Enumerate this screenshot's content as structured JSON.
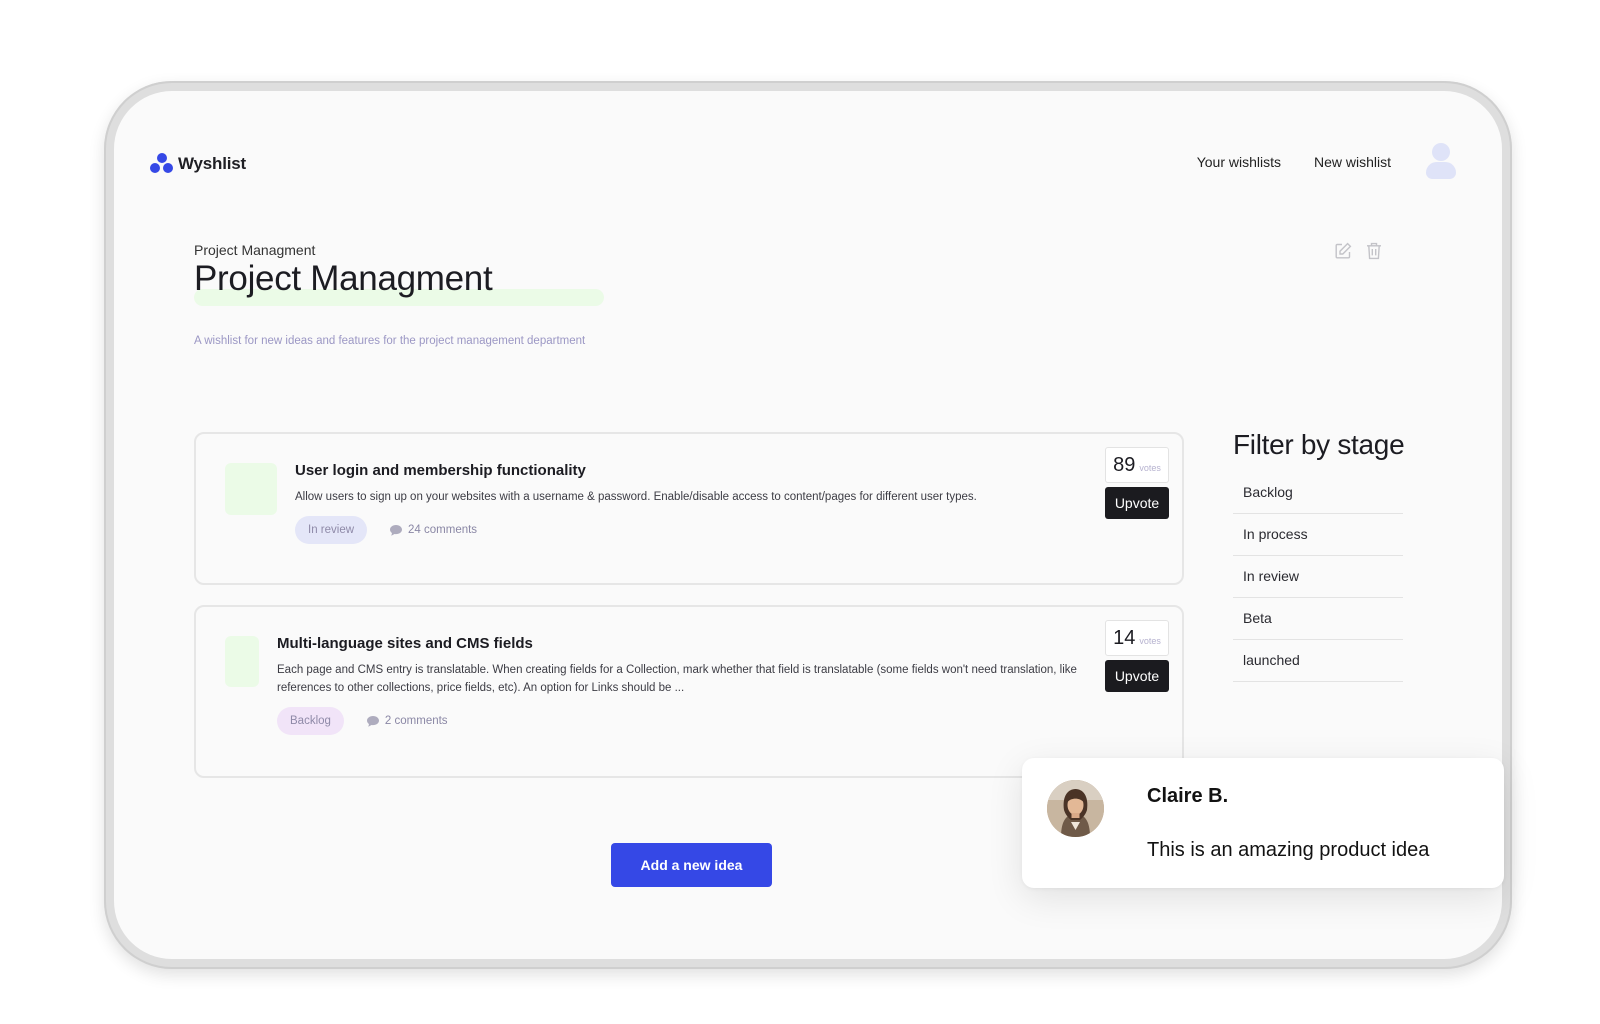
{
  "app": {
    "logo_text": "Wyshlist",
    "brand_color": "#3548e6"
  },
  "nav": {
    "your_wishlists": "Your wishlists",
    "new_wishlist": "New wishlist",
    "avatar_icon": "user-avatar-placeholder"
  },
  "page": {
    "breadcrumb": "Project Managment",
    "title": "Project Managment",
    "subtitle": "A wishlist for new ideas and features for the project management department",
    "actions": [
      "edit-icon",
      "trash-icon"
    ]
  },
  "ideas": [
    {
      "title": "User login and membership functionality",
      "description": "Allow users to sign up on your websites with a username & password. Enable/disable access to content/pages for different user types.",
      "stage": "In review",
      "comments": "24 comments",
      "votes": "89",
      "votes_label": "votes",
      "upvote_label": "Upvote"
    },
    {
      "title": "Multi-language sites and CMS fields",
      "description": "Each page and CMS entry is translatable. When creating fields for a Collection, mark whether that field is translatable (some fields won't need translation, like references to other collections, price fields, etc). An option for Links should be ...",
      "stage": "Backlog",
      "comments": "2 comments",
      "votes": "14",
      "votes_label": "votes",
      "upvote_label": "Upvote"
    }
  ],
  "filter": {
    "title": "Filter by stage",
    "stages": [
      "Backlog",
      "In process",
      "In review",
      "Beta",
      "launched"
    ]
  },
  "add_idea_label": "Add a new idea",
  "comment_popup": {
    "name": "Claire B.",
    "text": "This is an amazing product idea"
  }
}
